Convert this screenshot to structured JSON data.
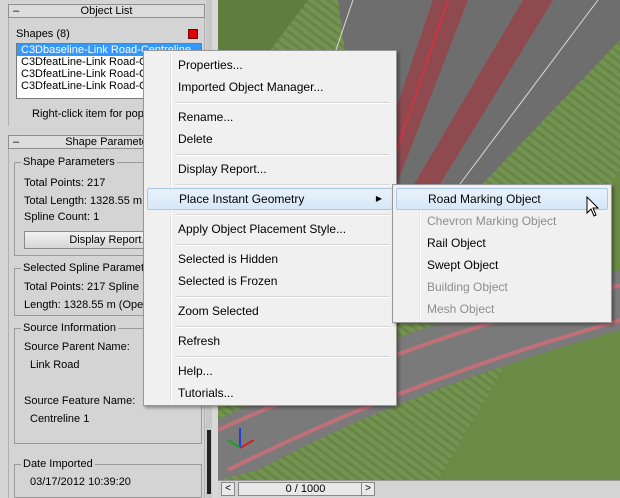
{
  "object_list": {
    "title": "Object List",
    "shapes_label": "Shapes (8)",
    "items": [
      "C3Dbaseline-Link Road-Centreline",
      "C3DfeatLine-Link Road-C",
      "C3DfeatLine-Link Road-C",
      "C3DfeatLine-Link Road-C"
    ],
    "hint": "Right-click item for pop-"
  },
  "shape_rollout": {
    "title": "Shape Paramete",
    "group_title": "Shape Parameters",
    "total_points": "Total Points:  217",
    "total_length": "Total Length:   1328.55 m",
    "spline_count": "Spline Count:  1",
    "display_report": "Display Report..."
  },
  "selected_spline": {
    "title": "Selected Spline Paramete",
    "total_points": "Total Points:  217  Spline",
    "length": "Length:  1328.55 m (Ope"
  },
  "source_info": {
    "title": "Source Information",
    "parent_label": "Source Parent Name:",
    "parent_value": "Link Road",
    "feature_label": "Source Feature Name:",
    "feature_value": "Centreline 1"
  },
  "date_imported": {
    "title": "Date Imported",
    "value": "03/17/2012 10:39:20"
  },
  "statusbar": {
    "prev": "<",
    "frame": "0 / 1000",
    "next": ">"
  },
  "context_menu": {
    "properties": "Properties...",
    "imported_object_manager": "Imported Object Manager...",
    "rename": "Rename...",
    "delete": "Delete",
    "display_report": "Display Report...",
    "place_instant_geometry": "Place Instant Geometry",
    "apply_placement_style": "Apply Object Placement Style...",
    "selected_hidden": "Selected is Hidden",
    "selected_frozen": "Selected is Frozen",
    "zoom_selected": "Zoom Selected",
    "refresh": "Refresh",
    "help": "Help...",
    "tutorials": "Tutorials..."
  },
  "submenu": {
    "road_marking": "Road Marking Object",
    "chevron_marking": "Chevron Marking Object",
    "rail": "Rail Object",
    "swept": "Swept Object",
    "building": "Building Object",
    "mesh": "Mesh Object"
  },
  "colors": {
    "selection": "#3399ff",
    "menu_highlight": "#d6e7f8",
    "road_marking_red": "#c8323c"
  }
}
